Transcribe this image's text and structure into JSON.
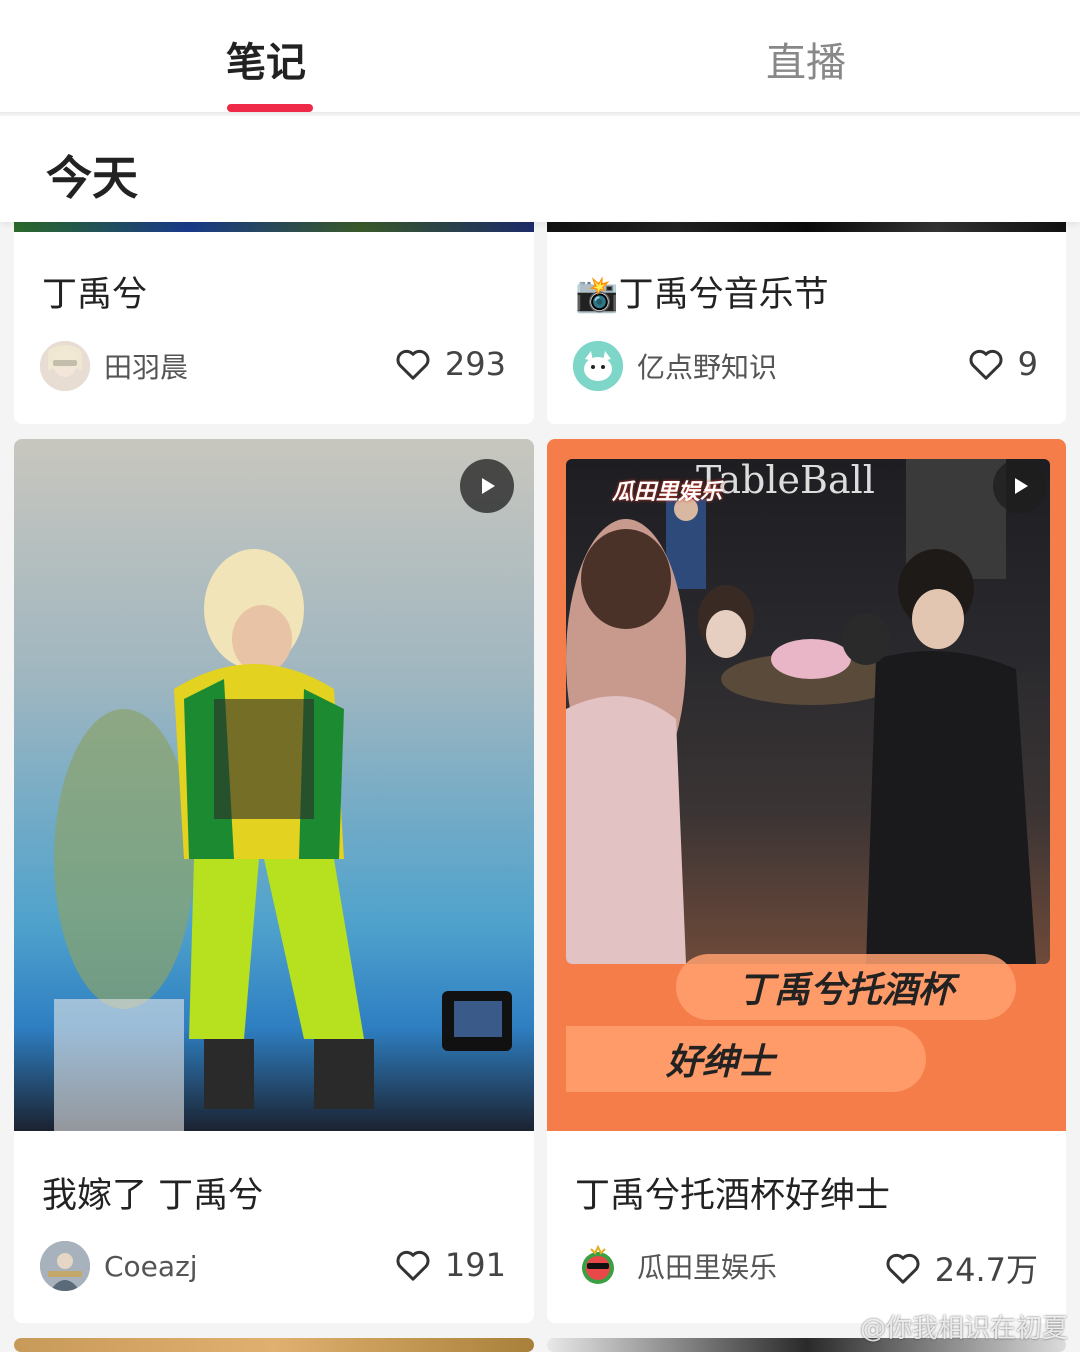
{
  "tabs": {
    "notes": "笔记",
    "live": "直播"
  },
  "section": {
    "title": "今天"
  },
  "cards": [
    {
      "title": "丁禹兮",
      "author": "田羽晨",
      "likes": "293"
    },
    {
      "title": "📸丁禹兮音乐节",
      "author": "亿点野知识",
      "likes": "9"
    },
    {
      "title": "我嫁了 丁禹兮",
      "author": "Coeazj",
      "likes": "191"
    },
    {
      "title": "丁禹兮托酒杯好绅士",
      "author": "瓜田里娱乐",
      "likes": "24.7万",
      "overlay_line1": "丁禹兮托酒杯",
      "overlay_line2": "好绅士",
      "brand_tag": "瓜田里娱乐",
      "brand_tag2": "TableBall"
    }
  ],
  "watermark": "@你我相识在初夏",
  "colors": {
    "accent": "#ee2a48",
    "overlay": "#f47d4a"
  }
}
